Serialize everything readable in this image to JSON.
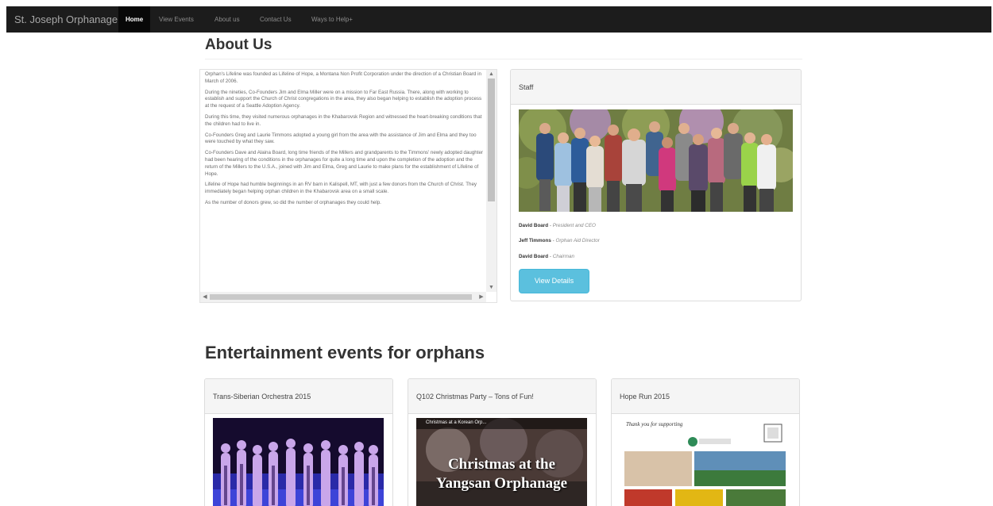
{
  "navbar": {
    "brand": "St. Joseph Orphanage",
    "items": [
      "Home",
      "View Events",
      "About us",
      "Contact Us",
      "Ways to Help+"
    ]
  },
  "about": {
    "title": "About Us",
    "paragraphs": [
      "Orphan's Lifeline was founded as Lifeline of Hope, a Montana Non Profit Corporation under the direction of a Christian Board in March of 2006.",
      "During the nineties, Co-Founders Jim and Elma Miller were on a mission to Far East Russia. There, along with working to establish and support the Church of Christ congregations in the area, they also began helping to establish the adoption process at the request of a Seattle Adoption Agency.",
      "During this time, they visited numerous orphanages in the Khabarovsk Region and witnessed the heart-breaking conditions that the children had to live in.",
      "Co-Founders Greg and Laurie Timmons adopted a young girl from the area with the assistance of Jim and Elma and they too were touched by what they saw.",
      "Co-Founders Dave and Alaina Board, long time friends of the Millers and grandparents to the Timmons' newly adopted daughter had been hearing of the conditions in the orphanages for quite a long time and upon the completion of the adoption and the return of the Millers to the U.S.A., joined with Jim and Elma, Greg and Laurie to make plans for the establishment of Lifeline of Hope.",
      "Lifeline of Hope had humble beginnings in an RV barn in Kalispell, MT, with just a few donors from the Church of Christ. They immediately began helping orphan children in the Khabarovsk area on a small scale.",
      "As the number of donors grew, so did the number of orphanages they could help."
    ]
  },
  "staff": {
    "heading": "Staff",
    "members": [
      {
        "name": "David Board",
        "role": "President and CEO"
      },
      {
        "name": "Jeff Timmons",
        "role": "Orphan Aid Director"
      },
      {
        "name": "David Board",
        "role": "Chairman"
      }
    ],
    "button": "View Details"
  },
  "events": {
    "title": "Entertainment events for orphans",
    "cards": [
      {
        "title": "Trans-Siberian Orchestra 2015"
      },
      {
        "title": "Q102 Christmas Party – Tons of Fun!",
        "video_title": "Christmas at a Korean Orp...",
        "caption_line1": "Christmas at the",
        "caption_line2": "Yangsan Orphanage"
      },
      {
        "title": "Hope Run 2015",
        "note": "Thank you for supporting"
      }
    ]
  },
  "colors": {
    "navbar": "#1c1c1c",
    "info_button": "#5bc0de",
    "panel_heading": "#f5f5f5"
  }
}
